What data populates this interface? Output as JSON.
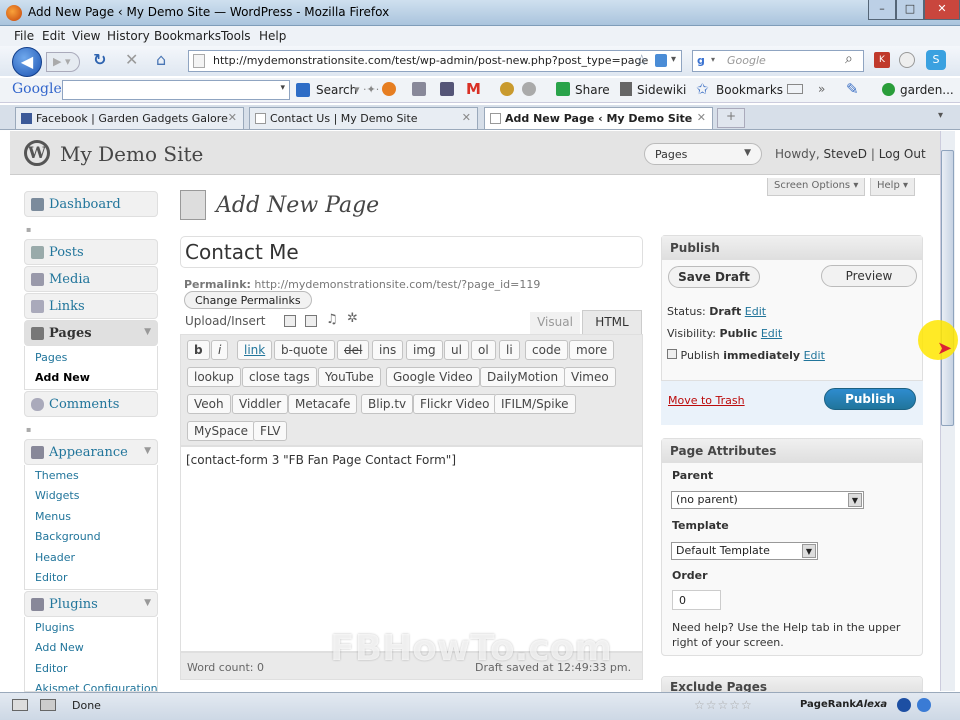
{
  "window": {
    "title": "Add New Page ‹ My Demo Site — WordPress - Mozilla Firefox"
  },
  "menubar": [
    "File",
    "Edit",
    "View",
    "History",
    "Bookmarks",
    "Tools",
    "Help"
  ],
  "navbar": {
    "url": "http://mydemonstrationsite.com/test/wp-admin/post-new.php?post_type=page",
    "search_placeholder": "Google"
  },
  "google_toolbar": {
    "logo": "Google",
    "search": "Search",
    "share": "Share",
    "sidewiki": "Sidewiki",
    "bookmarks": "Bookmarks",
    "garden": "garden..."
  },
  "tabs": [
    {
      "label": "Facebook | Garden Gadgets Galore"
    },
    {
      "label": "Contact Us | My Demo Site"
    },
    {
      "label": "Add New Page ‹ My Demo Site —..."
    }
  ],
  "wp_header": {
    "site_name": "My Demo Site",
    "favorite": "Pages",
    "howdy": "Howdy,",
    "user": "SteveD",
    "separator": "|",
    "logout": "Log Out"
  },
  "screen_options": {
    "screen_options": "Screen Options",
    "help": "Help"
  },
  "sidebar": {
    "dashboard": "Dashboard",
    "posts": "Posts",
    "media": "Media",
    "links": "Links",
    "pages": "Pages",
    "pages_sub": [
      "Pages",
      "Add New"
    ],
    "comments": "Comments",
    "appearance": "Appearance",
    "appearance_sub": [
      "Themes",
      "Widgets",
      "Menus",
      "Background",
      "Header",
      "Editor"
    ],
    "plugins": "Plugins",
    "plugins_sub": [
      "Plugins",
      "Add New",
      "Editor",
      "Akismet Configuration"
    ]
  },
  "main": {
    "heading": "Add New Page",
    "title_value": "Contact Me",
    "permalink_label": "Permalink:",
    "permalink_url": "http://mydemonstrationsite.com/test/?page_id=119",
    "change_permalinks": "Change Permalinks",
    "upload_insert": "Upload/Insert",
    "tab_visual": "Visual",
    "tab_html": "HTML",
    "quicktags": [
      "b",
      "i",
      "link",
      "b-quote",
      "del",
      "ins",
      "img",
      "ul",
      "ol",
      "li",
      "code",
      "more",
      "lookup",
      "close tags",
      "YouTube",
      "Google Video",
      "DailyMotion",
      "Vimeo",
      "Veoh",
      "Viddler",
      "Metacafe",
      "Blip.tv",
      "Flickr Video",
      "IFILM/Spike",
      "MySpace",
      "FLV"
    ],
    "content": "[contact-form 3 \"FB Fan Page Contact Form\"]",
    "word_count": "Word count: 0",
    "draft_saved": "Draft saved at 12:49:33 pm."
  },
  "publish": {
    "title": "Publish",
    "save_draft": "Save Draft",
    "preview": "Preview",
    "status_label": "Status:",
    "status_value": "Draft",
    "visibility_label": "Visibility:",
    "visibility_value": "Public",
    "publish_label": "Publish",
    "publish_value": "immediately",
    "edit": "Edit",
    "move_to_trash": "Move to Trash",
    "publish_button": "Publish"
  },
  "page_attributes": {
    "title": "Page Attributes",
    "parent_label": "Parent",
    "parent_value": "(no parent)",
    "template_label": "Template",
    "template_value": "Default Template",
    "order_label": "Order",
    "order_value": "0",
    "help_text": "Need help? Use the Help tab in the upper right of your screen."
  },
  "exclude_pages": {
    "title": "Exclude Pages"
  },
  "statusbar": {
    "text": "Done",
    "pagerank": "PageRank",
    "alexa": "Alexa"
  },
  "watermark": "FBHowTo.com"
}
